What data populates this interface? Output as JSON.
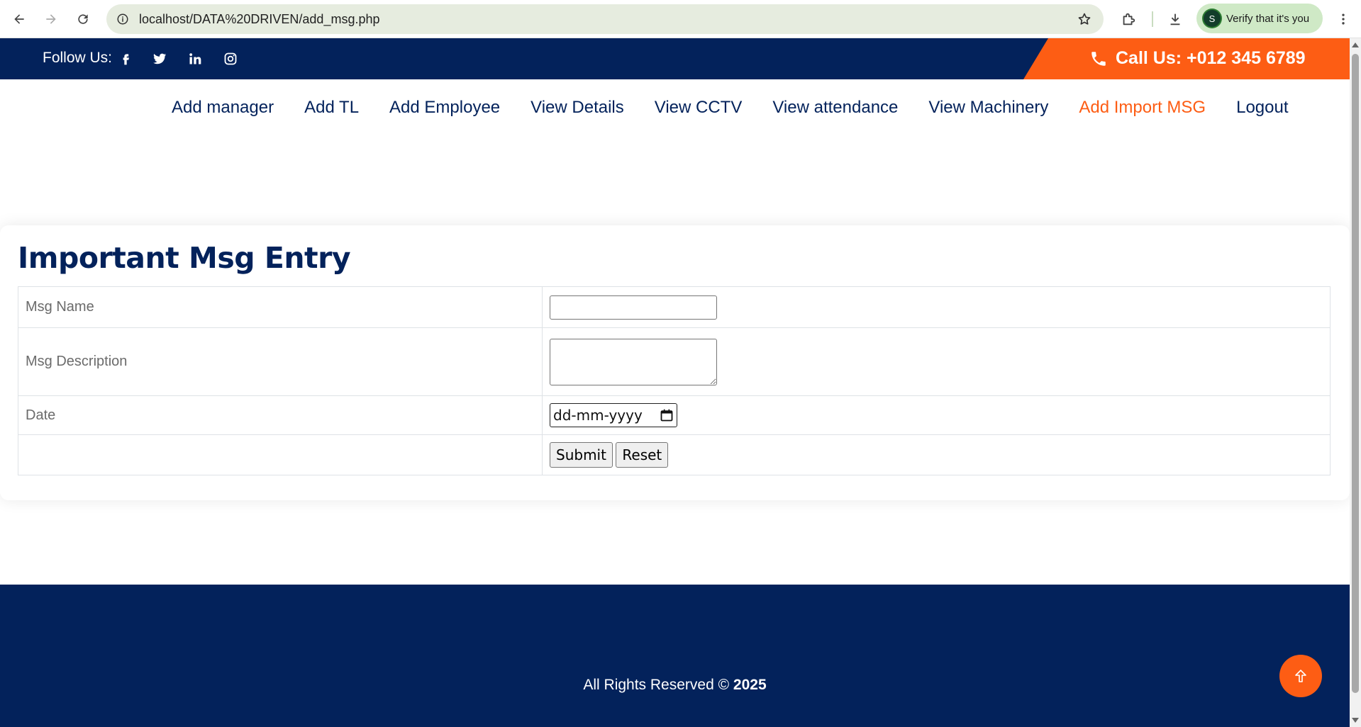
{
  "browser": {
    "url": "localhost/DATA%20DRIVEN/add_msg.php",
    "verify_label": "Verify that it's you",
    "avatar_letter": "S",
    "icons": [
      "back-icon",
      "forward-icon",
      "reload-icon",
      "site-info-icon",
      "star-icon",
      "extensions-icon",
      "download-icon",
      "menu-icon"
    ]
  },
  "topbar": {
    "follow_label": "Follow Us:",
    "social": [
      "facebook-icon",
      "twitter-icon",
      "linkedin-icon",
      "instagram-icon"
    ],
    "call_label": "Call Us:  +012 345 6789"
  },
  "nav": {
    "items": [
      {
        "label": "Add manager",
        "active": false
      },
      {
        "label": "Add TL",
        "active": false
      },
      {
        "label": "Add Employee",
        "active": false
      },
      {
        "label": "View Details",
        "active": false
      },
      {
        "label": "View CCTV",
        "active": false
      },
      {
        "label": "View attendance",
        "active": false
      },
      {
        "label": "View Machinery",
        "active": false
      },
      {
        "label": "Add Import MSG",
        "active": true
      },
      {
        "label": "Logout",
        "active": false
      }
    ]
  },
  "form": {
    "title": "Important Msg Entry",
    "fields": {
      "msg_name_label": "Msg Name",
      "msg_name_value": "",
      "msg_desc_label": "Msg Description",
      "msg_desc_value": "",
      "date_label": "Date",
      "date_placeholder": "dd-mm-yyyy"
    },
    "submit_label": "Submit",
    "reset_label": "Reset"
  },
  "footer": {
    "copyright_text": "All Rights Reserved © ",
    "copyright_year": "2025"
  },
  "colors": {
    "navy": "#03225b",
    "accent": "#fd5d14"
  }
}
